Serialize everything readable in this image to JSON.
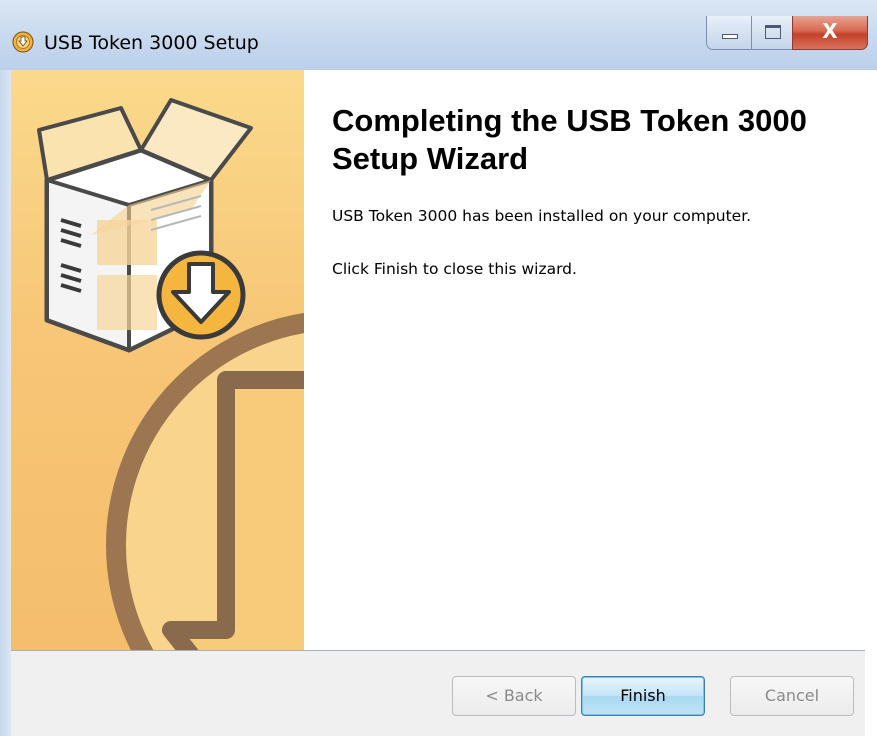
{
  "window": {
    "title": "USB Token 3000 Setup",
    "close_glyph": "X"
  },
  "content": {
    "heading": "Completing the USB Token 3000 Setup Wizard",
    "line1": "USB Token 3000 has been installed on your computer.",
    "line2": "Click Finish to close this wizard."
  },
  "buttons": {
    "back": "< Back",
    "finish": "Finish",
    "cancel": "Cancel"
  },
  "icons": {
    "title": "installer-disc-icon",
    "banner": "software-box-download-graphic"
  },
  "colors": {
    "banner": "#f6c46f",
    "finish_border": "#3c7fb1"
  }
}
